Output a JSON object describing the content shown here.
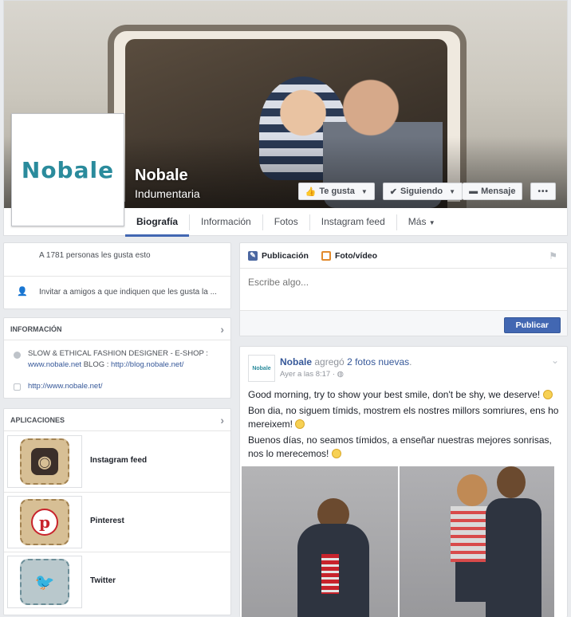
{
  "page": {
    "name": "Nobale",
    "category": "Indumentaria",
    "logo_text": "Nobale"
  },
  "actions": {
    "like": "Te gusta",
    "following": "Siguiendo",
    "message": "Mensaje",
    "more": "•••"
  },
  "tabs": [
    "Biografía",
    "Información",
    "Fotos",
    "Instagram feed",
    "Más"
  ],
  "likes": {
    "count_text": "A 1781 personas les gusta esto",
    "invite_text": "Invitar a amigos a que indiquen que les gusta la ..."
  },
  "info": {
    "title": "INFORMACIÓN",
    "description_prefix": "SLOW & ETHICAL FASHION DESIGNER - E-SHOP :",
    "description_link1": "www.nobale.net",
    "description_mid": " BLOG : ",
    "description_link2": "http://blog.nobale.net/",
    "website": "http://www.nobale.net/"
  },
  "apps": {
    "title": "APLICACIONES",
    "items": [
      {
        "label": "Instagram feed",
        "icon": "instagram-icon"
      },
      {
        "label": "Pinterest",
        "icon": "pinterest-icon"
      },
      {
        "label": "Twitter",
        "icon": "twitter-icon"
      }
    ]
  },
  "composer": {
    "tab_post": "Publicación",
    "tab_photo": "Foto/vídeo",
    "placeholder": "Escribe algo...",
    "publish": "Publicar"
  },
  "post": {
    "author": "Nobale",
    "action": " agregó ",
    "action_link": "2 fotos nuevas",
    "time": "Ayer a las 8:17 · ",
    "line1": "Good morning, try to show your best smile, don't be shy, we deserve!",
    "line2": "Bon dia, no siguem tímids, mostrem els nostres millors somriures, ens ho mereixem!",
    "line3": "Buenos días, no seamos tímidos, a enseñar nuestras mejores sonrisas, nos lo merecemos!"
  },
  "colors": {
    "brand_blue": "#4267b2",
    "link_blue": "#365899",
    "logo_teal": "#2a8b9c"
  }
}
